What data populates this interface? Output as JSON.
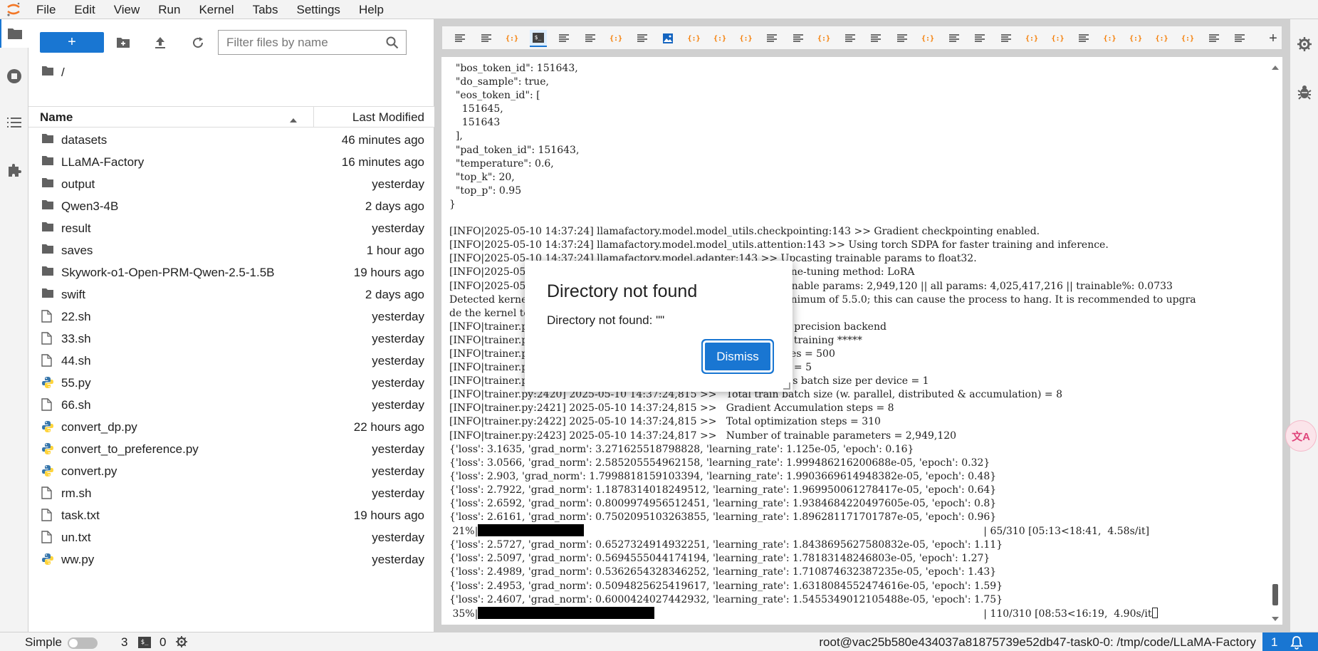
{
  "menubar": {
    "items": [
      "File",
      "Edit",
      "View",
      "Run",
      "Kernel",
      "Tabs",
      "Settings",
      "Help"
    ]
  },
  "filebrowser": {
    "new_label": "+",
    "filter_placeholder": "Filter files by name",
    "breadcrumb": "/",
    "columns": {
      "name": "Name",
      "modified": "Last Modified"
    },
    "files": [
      {
        "name": "datasets",
        "modified": "46 minutes ago",
        "type": "folder"
      },
      {
        "name": "LLaMA-Factory",
        "modified": "16 minutes ago",
        "type": "folder"
      },
      {
        "name": "output",
        "modified": "yesterday",
        "type": "folder"
      },
      {
        "name": "Qwen3-4B",
        "modified": "2 days ago",
        "type": "folder"
      },
      {
        "name": "result",
        "modified": "yesterday",
        "type": "folder"
      },
      {
        "name": "saves",
        "modified": "1 hour ago",
        "type": "folder"
      },
      {
        "name": "Skywork-o1-Open-PRM-Qwen-2.5-1.5B",
        "modified": "19 hours ago",
        "type": "folder"
      },
      {
        "name": "swift",
        "modified": "2 days ago",
        "type": "folder"
      },
      {
        "name": "22.sh",
        "modified": "yesterday",
        "type": "file"
      },
      {
        "name": "33.sh",
        "modified": "yesterday",
        "type": "file"
      },
      {
        "name": "44.sh",
        "modified": "yesterday",
        "type": "file"
      },
      {
        "name": "55.py",
        "modified": "yesterday",
        "type": "python"
      },
      {
        "name": "66.sh",
        "modified": "yesterday",
        "type": "file"
      },
      {
        "name": "convert_dp.py",
        "modified": "22 hours ago",
        "type": "python"
      },
      {
        "name": "convert_to_preference.py",
        "modified": "yesterday",
        "type": "python"
      },
      {
        "name": "convert.py",
        "modified": "yesterday",
        "type": "python"
      },
      {
        "name": "rm.sh",
        "modified": "yesterday",
        "type": "file"
      },
      {
        "name": "task.txt",
        "modified": "19 hours ago",
        "type": "file"
      },
      {
        "name": "un.txt",
        "modified": "yesterday",
        "type": "file"
      },
      {
        "name": "ww.py",
        "modified": "yesterday",
        "type": "python"
      }
    ]
  },
  "notebook_toolbar": {
    "tabs": [
      "text",
      "text",
      "json",
      "terminal",
      "text",
      "text",
      "json",
      "text",
      "image",
      "json",
      "json",
      "json",
      "text",
      "text",
      "json",
      "text",
      "text",
      "text",
      "json",
      "text",
      "text",
      "text",
      "json",
      "json",
      "text",
      "json",
      "json",
      "json",
      "json",
      "text",
      "text"
    ],
    "active_index": 3,
    "add_label": "+"
  },
  "output": {
    "pre_lines": [
      "  \"bos_token_id\": 151643,",
      "  \"do_sample\": true,",
      "  \"eos_token_id\": [",
      "    151645,",
      "    151643",
      "  ],",
      "  \"pad_token_id\": 151643,",
      "  \"temperature\": 0.6,",
      "  \"top_k\": 20,",
      "  \"top_p\": 0.95",
      "}",
      "",
      "[INFO|2025-05-10 14:37:24] llamafactory.model.model_utils.checkpointing:143 >> Gradient checkpointing enabled.",
      "[INFO|2025-05-10 14:37:24] llamafactory.model.model_utils.attention:143 >> Using torch SDPA for faster training and inference.",
      "[INFO|2025-05-10 14:37:24] llamafactory.model.adapter:143 >> Upcasting trainable params to float32.",
      "[INFO|2025-05-10 14:37:24] llamafactory.model.adapter:143 >> Fine-tuning method: LoRA",
      "[INFO|2025-05-10 14:37:24] llamafactory.model.loader:143 >> trainable params: 2,949,120 || all params: 4,025,417,216 || trainable%: 0.0733",
      "Detected kernel version 5.4.0, which is below the recommended minimum of 5.5.0; this can cause the process to hang. It is recommended to upgra",
      "de the kernel to the minimum version or higher.",
      "[INFO|trainer.py:748] 2025-05-10 14:37:24,811 >> Using auto half precision backend",
      "[INFO|trainer.py:2414] 2025-05-10 14:37:24,815 >> ***** Running training *****",
      "[INFO|trainer.py:2415] 2025-05-10 14:37:24,815 >>   Num examples = 500",
      "[INFO|trainer.py:2416] 2025-05-10 14:37:24,815 >>   Num Epochs = 5",
      "[INFO|trainer.py:2417] 2025-05-10 14:37:24,815 >>   Instantaneous batch size per device = 1",
      "[INFO|trainer.py:2420] 2025-05-10 14:37:24,815 >>   Total train batch size (w. parallel, distributed & accumulation) = 8",
      "[INFO|trainer.py:2421] 2025-05-10 14:37:24,815 >>   Gradient Accumulation steps = 8",
      "[INFO|trainer.py:2422] 2025-05-10 14:37:24,815 >>   Total optimization steps = 310",
      "[INFO|trainer.py:2423] 2025-05-10 14:37:24,817 >>   Number of trainable parameters = 2,949,120",
      "{'loss': 3.1635, 'grad_norm': 3.271625518798828, 'learning_rate': 1.125e-05, 'epoch': 0.16}",
      "{'loss': 3.0566, 'grad_norm': 2.585205554962158, 'learning_rate': 1.999486216200688e-05, 'epoch': 0.32}",
      "{'loss': 2.903, 'grad_norm': 1.7998818159103394, 'learning_rate': 1.9903669614948382e-05, 'epoch': 0.48}",
      "{'loss': 2.7922, 'grad_norm': 1.1878314018249512, 'learning_rate': 1.969950061278417e-05, 'epoch': 0.64}",
      "{'loss': 2.6592, 'grad_norm': 0.8009974956512451, 'learning_rate': 1.9384684220497605e-05, 'epoch': 0.8}",
      "{'loss': 2.6161, 'grad_norm': 0.7502095103263855, 'learning_rate': 1.896281171701787e-05, 'epoch': 0.96}"
    ],
    "progress1": {
      "percent": " 21%|",
      "fraction": 0.21,
      "tail": "| 65/310 [05:13<18:41,  4.58s/it]"
    },
    "mid_lines": [
      "{'loss': 2.5727, 'grad_norm': 0.6527324914932251, 'learning_rate': 1.8438695627580832e-05, 'epoch': 1.11}",
      "{'loss': 2.5097, 'grad_norm': 0.5694555044174194, 'learning_rate': 1.78183148246803e-05, 'epoch': 1.27}",
      "{'loss': 2.4989, 'grad_norm': 0.5362654328346252, 'learning_rate': 1.710874632387235e-05, 'epoch': 1.43}",
      "{'loss': 2.4953, 'grad_norm': 0.5094825625419617, 'learning_rate': 1.6318084552474616e-05, 'epoch': 1.59}",
      "{'loss': 2.4607, 'grad_norm': 0.6000424027442932, 'learning_rate': 1.5455349012105488e-05, 'epoch': 1.75}"
    ],
    "progress2": {
      "percent": " 35%|",
      "fraction": 0.35,
      "tail": "| 110/310 [08:53<16:19,  4.90s/it"
    }
  },
  "statusbar": {
    "mode_label": "Simple",
    "kernels": "3",
    "terminal_icon": "$_",
    "terminals": "0",
    "path": "root@vac25b580e434037a81875739e52db47-task0-0: /tmp/code/LLaMA-Factory",
    "notifications": "1"
  },
  "dialog": {
    "title": "Directory not found",
    "body": "Directory not found: \"\"",
    "button": "Dismiss"
  },
  "colors": {
    "accent": "#1976d2",
    "folder": "#616161",
    "python_blue": "#3776ab",
    "python_yellow": "#ffd43b",
    "json_orange": "#f57c00"
  }
}
